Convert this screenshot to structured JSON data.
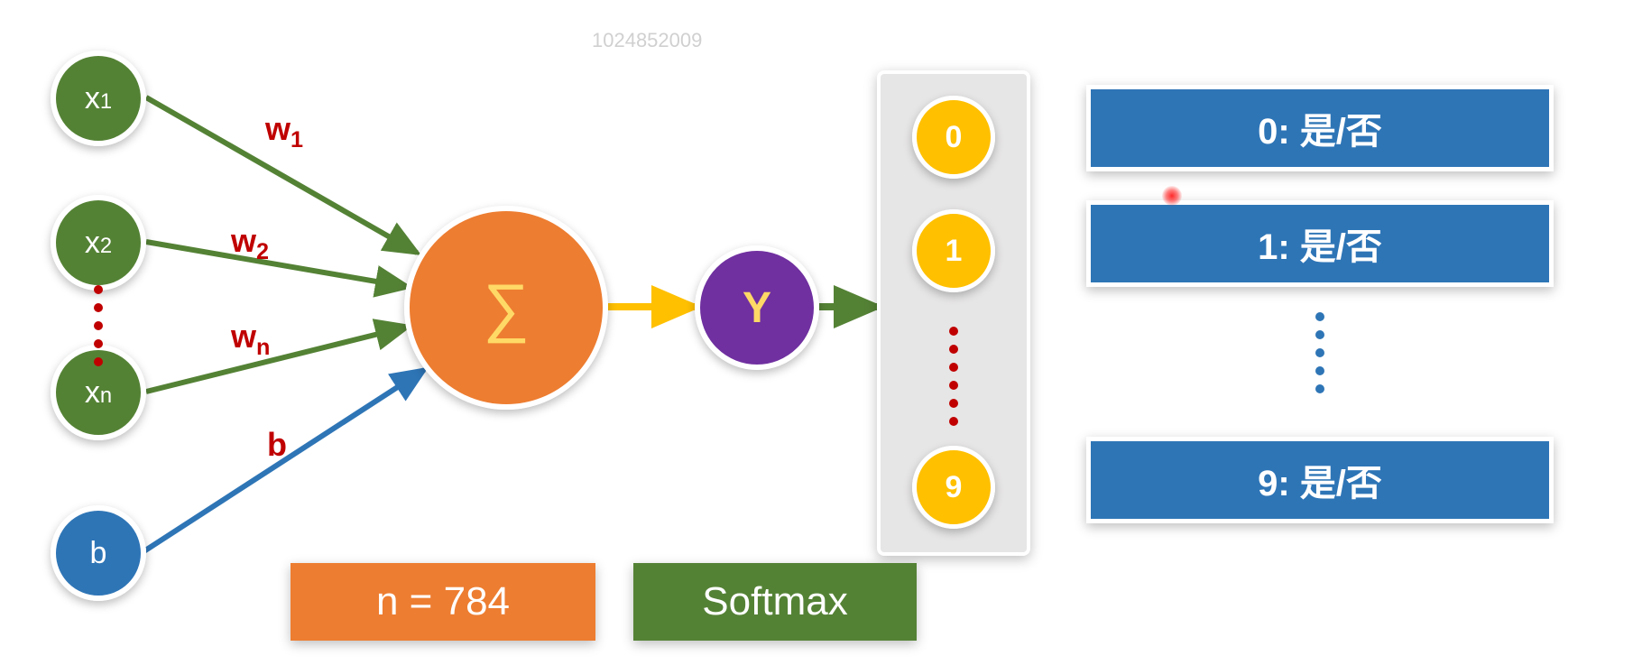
{
  "watermark": "1024852009",
  "inputs": {
    "x1": {
      "base": "x",
      "sub": "1"
    },
    "x2": {
      "base": "x",
      "sub": "2"
    },
    "xn": {
      "base": "x",
      "sub": "n"
    },
    "b": {
      "base": "b",
      "sub": ""
    }
  },
  "weights": {
    "w1": {
      "base": "w",
      "sub": "1"
    },
    "w2": {
      "base": "w",
      "sub": "2"
    },
    "wn": {
      "base": "w",
      "sub": "n"
    },
    "b": {
      "base": "b",
      "sub": ""
    }
  },
  "sum_symbol": "∑",
  "y_symbol": "Y",
  "outputs": {
    "o0": "0",
    "o1": "1",
    "o9": "9"
  },
  "classes": {
    "c0": "0: 是/否",
    "c1": "1: 是/否",
    "c9": "9: 是/否"
  },
  "annotation_n": "n = 784",
  "annotation_softmax": "Softmax",
  "colors": {
    "green": "#548235",
    "blue": "#2E75B6",
    "orange": "#ED7D31",
    "purple": "#7030A0",
    "yellow": "#FFC000",
    "red": "#C00000"
  }
}
